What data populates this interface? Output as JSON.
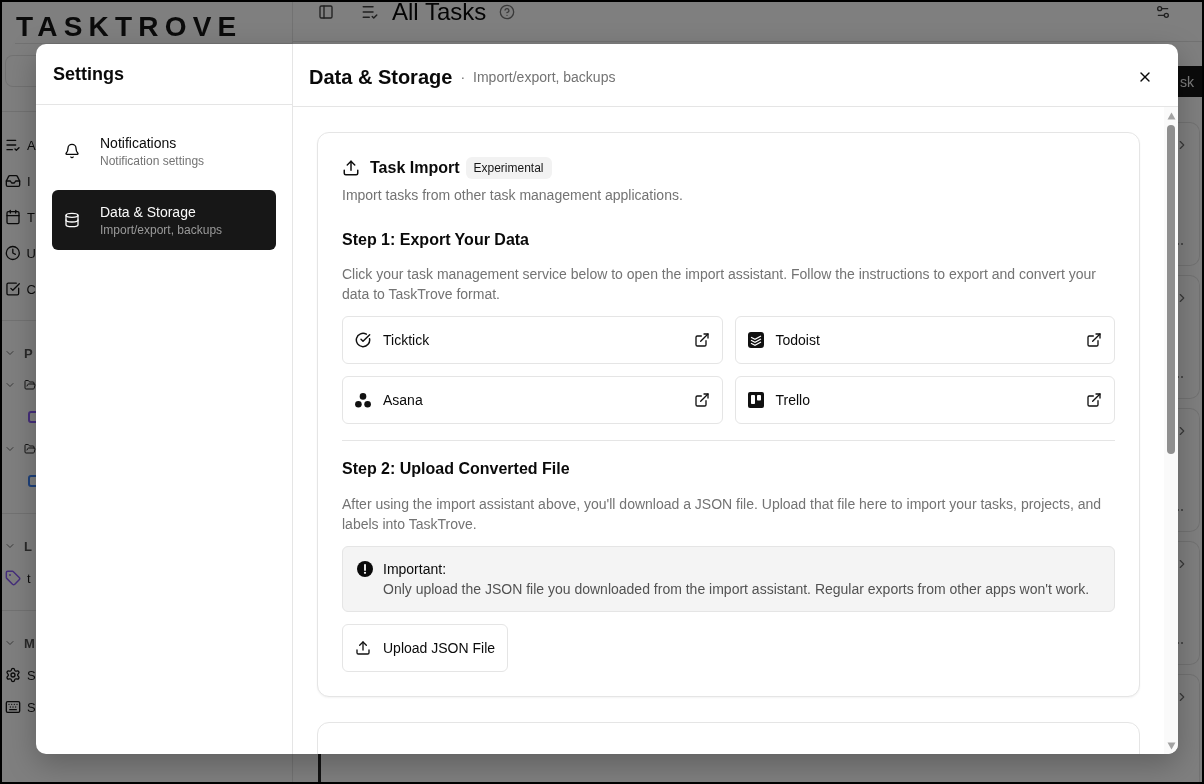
{
  "app": {
    "logo": "TASKTROVE",
    "sidebar": {
      "nav_items": [
        {
          "label": "A"
        },
        {
          "label": "I"
        },
        {
          "label": "T"
        },
        {
          "label": "U"
        },
        {
          "label": "C"
        }
      ],
      "groups": [
        {
          "title": "P",
          "expanded": true,
          "items": [
            {
              "kind": "folder",
              "expanded": true,
              "children": [
                {
                  "kind": "project",
                  "color": "#452e7b"
                }
              ]
            },
            {
              "kind": "folder",
              "expanded": true,
              "children": [
                {
                  "kind": "project",
                  "color": "#1e417b"
                }
              ]
            }
          ]
        },
        {
          "title": "L",
          "expanded": true,
          "items": [
            {
              "kind": "label",
              "label": "t",
              "color": "#452e7b"
            }
          ]
        },
        {
          "title": "M",
          "expanded": true,
          "items": [
            {
              "kind": "link",
              "label": "S"
            },
            {
              "kind": "link",
              "label": "S"
            }
          ]
        }
      ]
    },
    "header": {
      "title": "All Tasks"
    },
    "add_button": "sk"
  },
  "settings_dialog": {
    "title": "Settings",
    "nav": [
      {
        "title": "Notifications",
        "subtitle": "Notification settings",
        "selected": false
      },
      {
        "title": "Data & Storage",
        "subtitle": "Import/export, backups",
        "selected": true
      }
    ],
    "page_title": "Data & Storage",
    "separator": "·",
    "page_subtitle": "Import/export, backups",
    "sections": [
      {
        "title": "Task Import",
        "badge": "Experimental",
        "description": "Import tasks from other task management applications.",
        "steps": [
          {
            "kind": "services",
            "title": "Step 1: Export Your Data",
            "text": "Click your task management service below to open the import assistant. Follow the instructions to export and convert your data to TaskTrove format.",
            "services": [
              "Ticktick",
              "Todoist",
              "Asana",
              "Trello"
            ]
          },
          {
            "kind": "upload",
            "title": "Step 2: Upload Converted File",
            "text": "After using the import assistant above, you'll download a JSON file. Upload that file here to import your tasks, projects, and labels into TaskTrove.",
            "notice": {
              "title": "Important:",
              "text": "Only upload the JSON file you downloaded from the import assistant. Regular exports from other apps won't work."
            },
            "button": "Upload JSON File"
          }
        ]
      }
    ]
  }
}
